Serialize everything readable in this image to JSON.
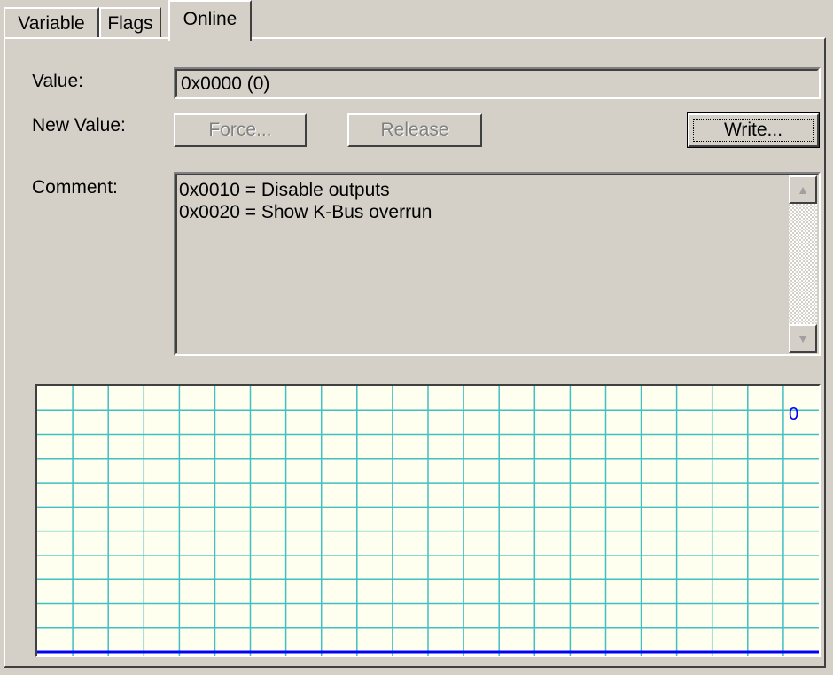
{
  "tabs": [
    {
      "label": "Variable"
    },
    {
      "label": "Flags"
    },
    {
      "label": "Online"
    }
  ],
  "online": {
    "value_label": "Value:",
    "value_text": "0x0000 (0)",
    "new_value_label": "New Value:",
    "force_label": "Force...",
    "release_label": "Release",
    "write_label": "Write...",
    "comment_label": "Comment:",
    "comment_text": "0x0010 = Disable outputs\n0x0020 = Show K-Bus overrun"
  },
  "graph": {
    "current_value": "0",
    "grid_color": "#40c0c0",
    "trace_color": "#0000ff",
    "background": "#fffff0"
  }
}
